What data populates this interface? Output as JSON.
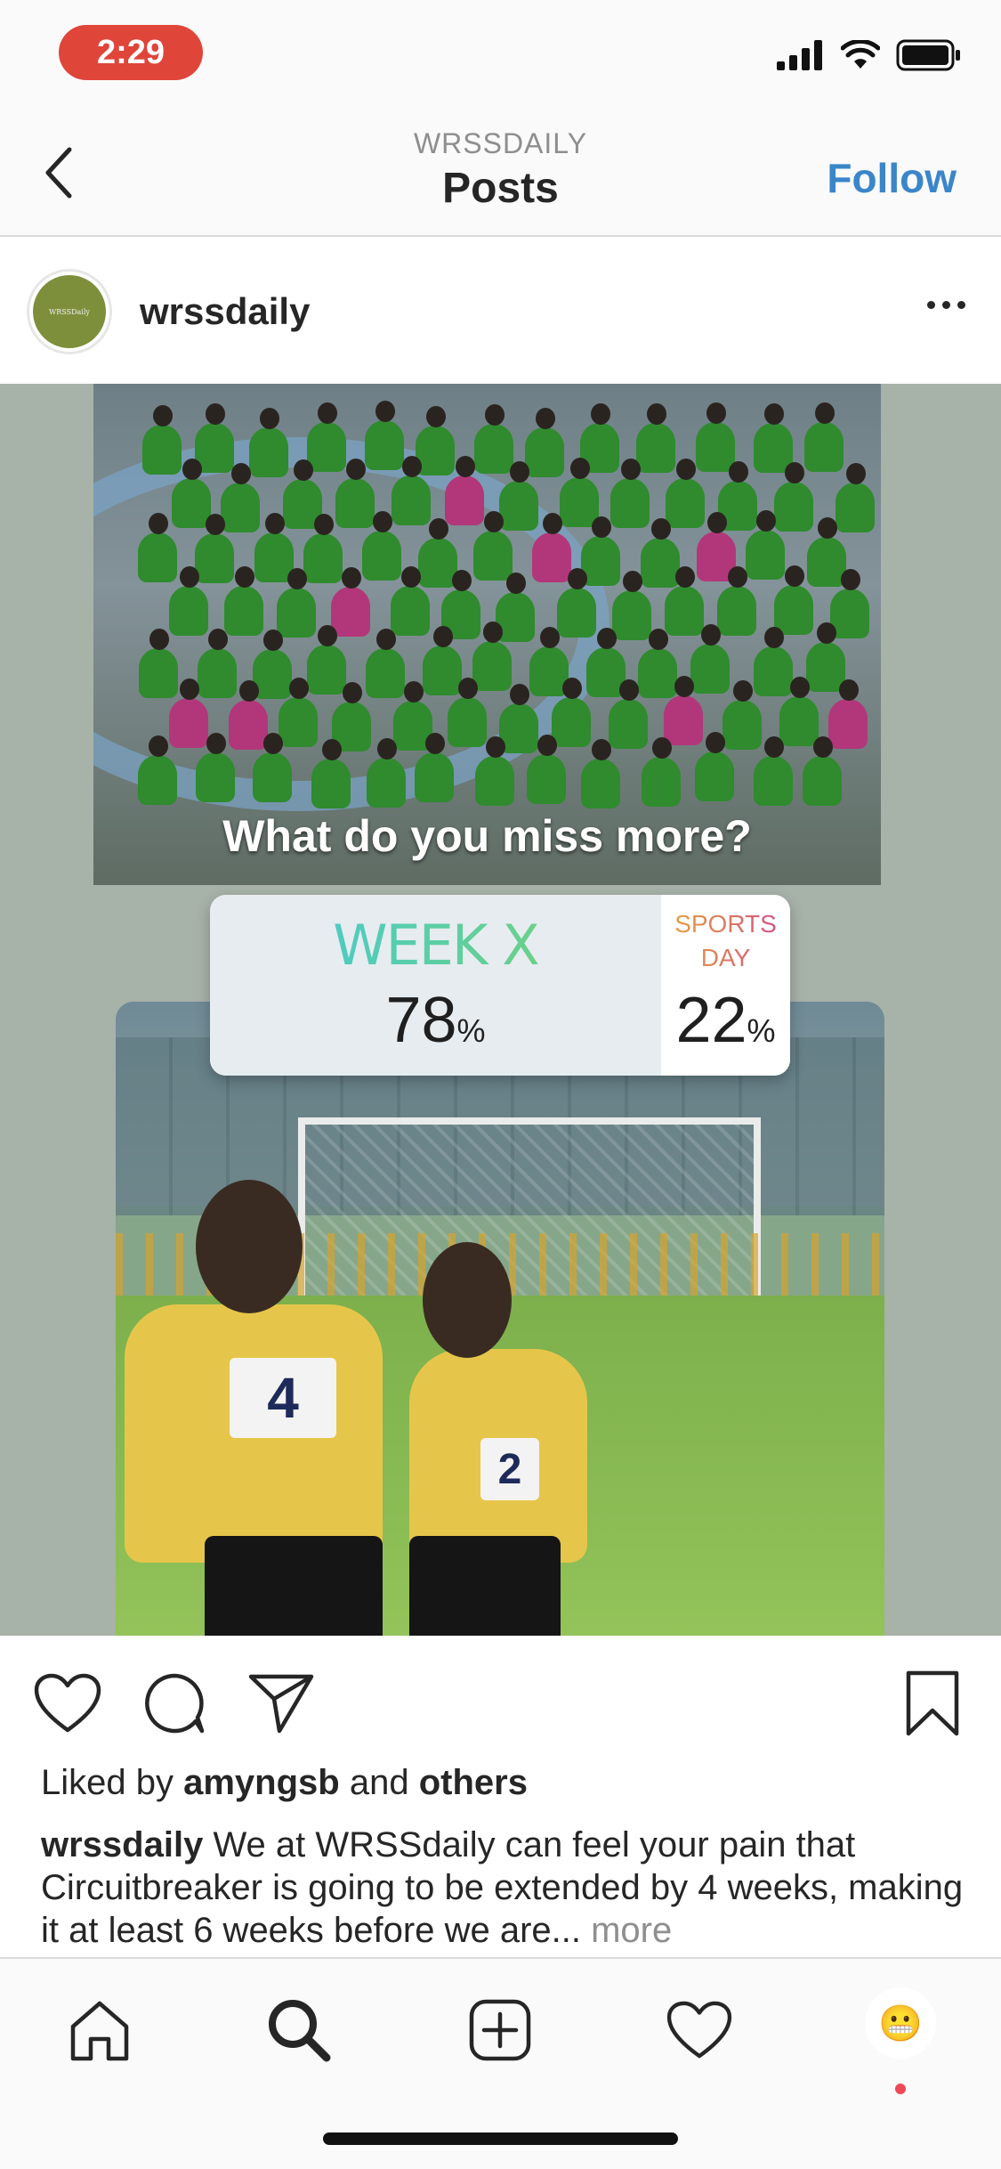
{
  "status_bar": {
    "time": "2:29"
  },
  "nav": {
    "subtitle": "WRSSDAILY",
    "title": "Posts",
    "follow_label": "Follow"
  },
  "post": {
    "username": "wrssdaily",
    "avatar_text": "WRSSDaily",
    "image_caption": "What do you miss more?",
    "poll": {
      "option_a_label": "WEEK X",
      "option_a_pct": "78",
      "option_b_label_line1": "SPORTS",
      "option_b_label_line2": "DAY",
      "option_b_pct": "22",
      "pct_sign": "%"
    },
    "bibs": [
      "4",
      "2"
    ],
    "likes_prefix": "Liked by",
    "likes_user": "amyngsb",
    "likes_and": "and",
    "likes_others": "others",
    "caption_user": "wrssdaily",
    "caption_text": "We at WRSSdaily can feel your pain that Circuitbreaker is going to be extended by 4 weeks, making it at least 6 weeks before we are...",
    "more_label": "more"
  },
  "tab_bar": {
    "items": [
      "home-icon",
      "search-icon",
      "new-post-icon",
      "activity-icon",
      "profile-avatar"
    ],
    "profile_emoji": "😬"
  },
  "colors": {
    "follow": "#3a86c8",
    "time_pill": "#e0453a",
    "notif_dot": "#ed4956"
  }
}
